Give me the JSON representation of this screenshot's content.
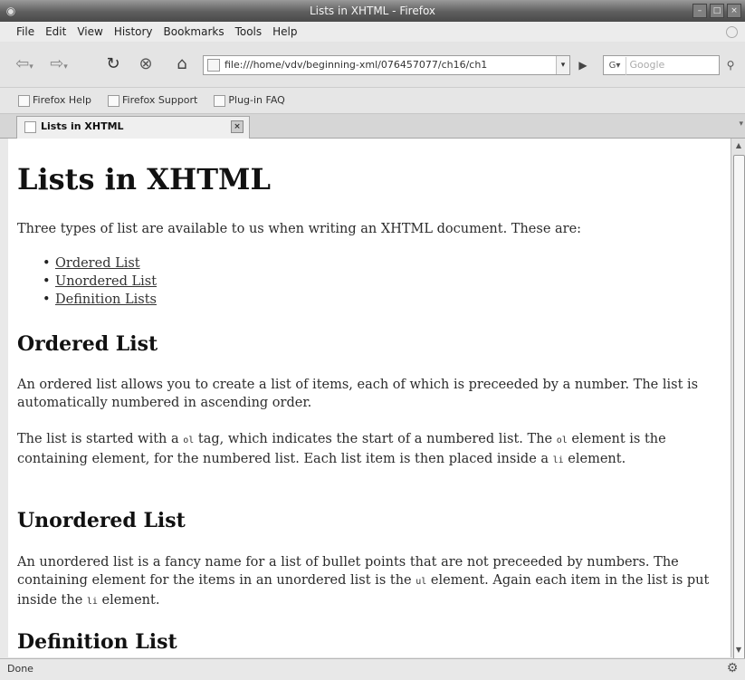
{
  "window": {
    "title": "Lists in XHTML - Firefox"
  },
  "menu": [
    "File",
    "Edit",
    "View",
    "History",
    "Bookmarks",
    "Tools",
    "Help"
  ],
  "toolbar": {
    "url": "file:///home/vdv/beginning-xml/076457077/ch16/ch1",
    "search_engine": "G",
    "search_placeholder": "Google"
  },
  "bookmarks": [
    "Firefox Help",
    "Firefox Support",
    "Plug-in FAQ"
  ],
  "tab": {
    "title": "Lists in XHTML"
  },
  "page": {
    "heading": "Lists in XHTML",
    "intro": "Three types of list are available to us when writing an XHTML document. These are:",
    "toc": [
      "Ordered List",
      "Unordered List",
      "Definition Lists"
    ],
    "sections": [
      {
        "title": "Ordered List",
        "p1": "An ordered list allows you to create a list of items, each of which is preceeded by a number. The list is automatically numbered in ascending order.",
        "p2_a": "The list is started with a ",
        "p2_code1": "ol",
        "p2_b": " tag, which indicates the start of a numbered list. The ",
        "p2_code2": "ol",
        "p2_c": " element is the containing element, for the numbered list. Each list item is then placed inside a ",
        "p2_code3": "li",
        "p2_d": " element."
      },
      {
        "title": "Unordered List",
        "p1_a": "An unordered list is a fancy name for a list of bullet points that are not preceeded by numbers. The containing element for the items in an unordered list is the ",
        "p1_code1": "ul",
        "p1_b": " element. Again each item in the list is put inside the ",
        "p1_code2": "li",
        "p1_c": " element."
      },
      {
        "title": "Definition List"
      }
    ]
  },
  "status": {
    "text": "Done"
  }
}
